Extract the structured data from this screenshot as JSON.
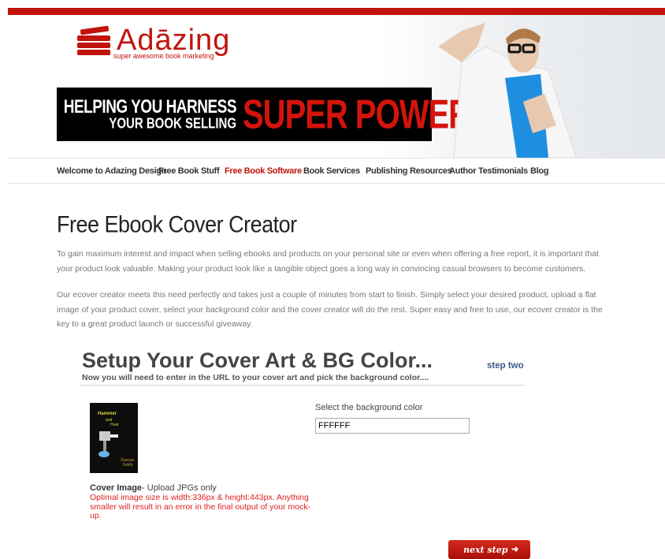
{
  "header": {
    "logo_text": "Adāzing",
    "logo_tagline": "super awesome book marketing",
    "banner_line1": "HELPING YOU HARNESS",
    "banner_line2": "YOUR BOOK SELLING",
    "banner_big": "SUPER POWERS"
  },
  "nav": {
    "items": [
      {
        "label": "Welcome to Adazing Design"
      },
      {
        "label": "Free Book Stuff"
      },
      {
        "label": "Free Book Software"
      },
      {
        "label": "Book Services"
      },
      {
        "label": "Publishing Resources"
      },
      {
        "label": "Author Testimonials"
      },
      {
        "label": "Blog"
      }
    ],
    "active_color": "#c0140c"
  },
  "page": {
    "title": "Free Ebook Cover Creator",
    "para1": "To gain maximum interest and impact when selling ebooks and products on your personal site or even when offering a free report, it is important that your product look valuable. Making your product look like a tangible object goes a long way in convincing casual browsers to become customers.",
    "para2": "Our ecover creator meets this need perfectly and takes just a couple of minutes from start to finish. Simply select your desired product, upload a flat image of your product cover, select your background color and the cover creator will do the rest. Super easy and free to use, our ecover creator is the key to a great product launch or successful giveaway."
  },
  "setup": {
    "title": "Setup Your Cover Art & BG Color...",
    "subtitle": "Now you will need to enter in the URL to your cover art and pick the background color....",
    "step": "step two",
    "cover": {
      "thumb_title": "Hammer",
      "thumb_and": "and",
      "thumb_word": "Heat",
      "thumb_author": "Duncan Smith",
      "label_bold": "Cover Image",
      "label_rest": "- Upload JPGs only",
      "warning": "Optimal image size is width:336px & height:443px. Anything smaller will result in an error in the final output of your mock-up."
    },
    "bg_color": {
      "label": "Select the background color",
      "value": "FFFFFF"
    },
    "next_button": "next step",
    "next_icon": "arrow-right-icon"
  },
  "colors": {
    "brand_red": "#c0140c",
    "step_blue": "#3d5a8a",
    "warning_red": "#e02020"
  }
}
